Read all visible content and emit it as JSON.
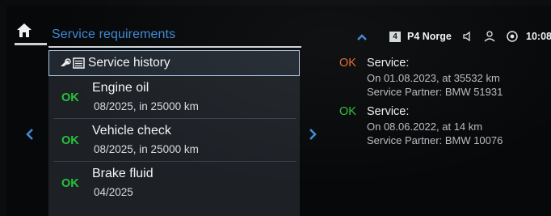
{
  "header": {
    "title": "Service requirements"
  },
  "service_history": {
    "label": "Service history"
  },
  "items": [
    {
      "status": "OK",
      "name": "Engine oil",
      "detail": "08/2025, in 25000 km"
    },
    {
      "status": "OK",
      "name": "Vehicle check",
      "detail": "08/2025, in 25000 km"
    },
    {
      "status": "OK",
      "name": "Brake fluid",
      "detail": "04/2025"
    }
  ],
  "nav": {
    "left_arrow": "‹",
    "right_arrow": "›"
  },
  "status_bar": {
    "preset_number": "4",
    "station": "P4 Norge",
    "clock": "10:08"
  },
  "history": [
    {
      "status": "OK",
      "title": "Service:",
      "date_line": "On 01.08.2023, at 35532 km",
      "partner_line": "Service Partner: BMW 51931"
    },
    {
      "status": "OK",
      "title": "Service:",
      "date_line": "On 08.06.2022, at 14 km",
      "partner_line": "Service Partner: BMW 10076"
    }
  ],
  "colors": {
    "accent": "#3e8ad6",
    "ok_green": "#27c23c",
    "ok_orange": "#e0692e"
  }
}
